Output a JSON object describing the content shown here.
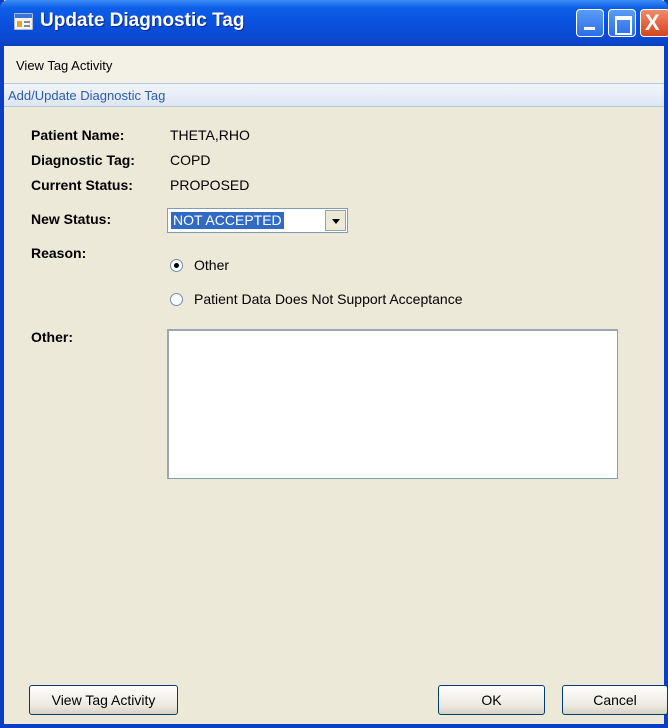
{
  "window": {
    "title": "Update Diagnostic Tag",
    "close_glyph": "X"
  },
  "menu": {
    "view_tag_activity": "View Tag Activity"
  },
  "section": {
    "header": "Add/Update Diagnostic Tag"
  },
  "form": {
    "patient_name_label": "Patient Name:",
    "patient_name_value": "THETA,RHO",
    "diagnostic_tag_label": "Diagnostic Tag:",
    "diagnostic_tag_value": "COPD",
    "current_status_label": "Current Status:",
    "current_status_value": "PROPOSED",
    "new_status_label": "New Status:",
    "new_status_value": "NOT ACCEPTED",
    "reason_label": "Reason:",
    "reason_options": [
      {
        "label": "Other",
        "checked": true
      },
      {
        "label": "Patient Data Does Not Support Acceptance",
        "checked": false
      }
    ],
    "other_label": "Other:",
    "other_value": ""
  },
  "buttons": {
    "view_tag_activity": "View Tag Activity",
    "ok": "OK",
    "cancel": "Cancel"
  },
  "colors": {
    "titlebar": "#0a4fdc",
    "selection": "#316ac5",
    "section_header_text": "#2c5caa",
    "dialog_background": "#ece9d8"
  },
  "icons": {
    "app": "app-window-icon",
    "minimize": "minimize-icon",
    "maximize": "maximize-icon",
    "close": "close-icon",
    "dropdown": "chevron-down-icon"
  }
}
